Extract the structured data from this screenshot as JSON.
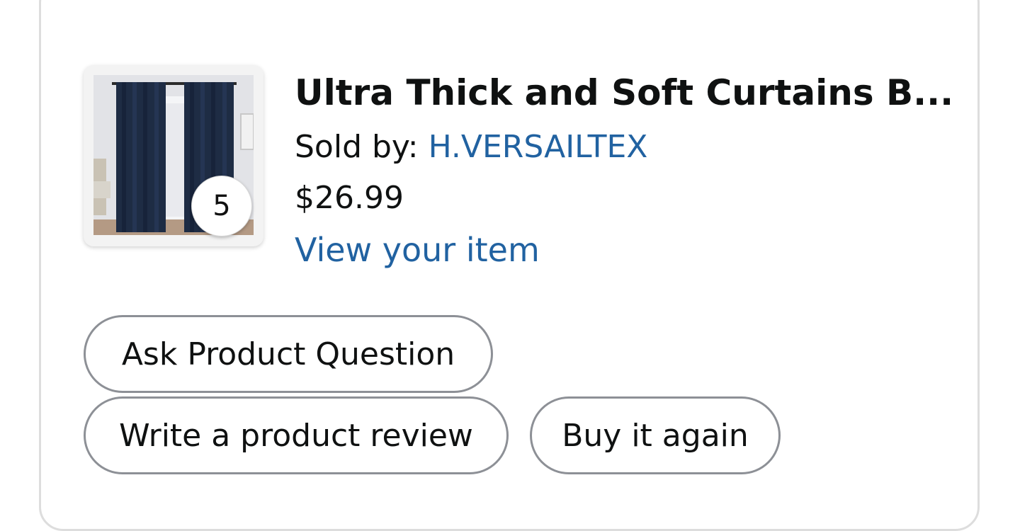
{
  "product": {
    "title": "Ultra Thick and Soft Curtains B...",
    "sold_by_label": "Sold by: ",
    "seller": "H.VERSAILTEX",
    "price": "$26.99",
    "view_item_label": "View your item",
    "quantity": "5",
    "image_icon": "curtains-product-image"
  },
  "actions": {
    "ask_question": "Ask Product Question",
    "write_review": "Write a product review",
    "buy_again": "Buy it again"
  },
  "colors": {
    "link": "#2162a1",
    "text": "#0f1111",
    "pill_border": "#8d9096",
    "card_border": "#dddddd"
  }
}
